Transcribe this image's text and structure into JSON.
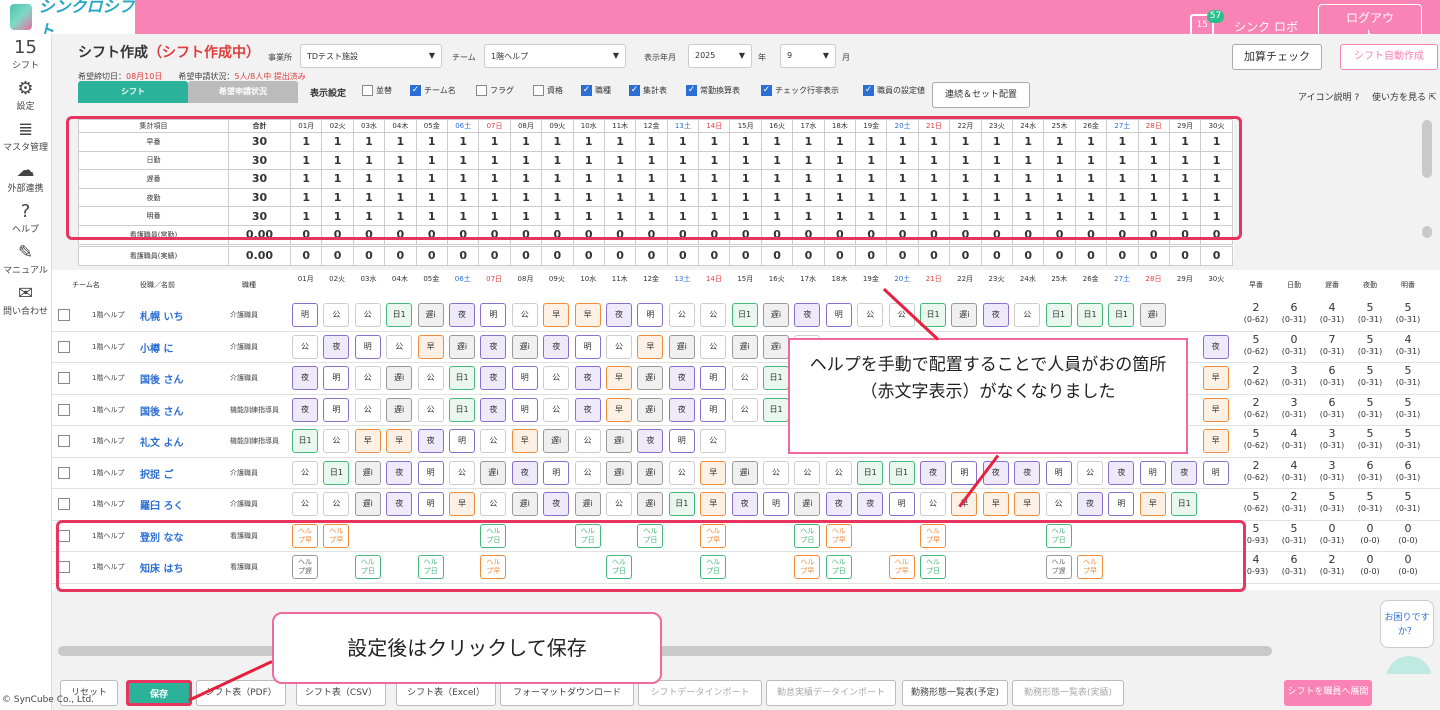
{
  "app": {
    "logo_text": "シンクロシフト",
    "notif_count": "57",
    "cal_day": "15",
    "user": "シンク ロボ",
    "logout": "ログアウト"
  },
  "sidebar": [
    {
      "icon": "calendar-icon",
      "glyph": "15",
      "label": "シフト"
    },
    {
      "icon": "gear-icon",
      "glyph": "⚙",
      "label": "設定"
    },
    {
      "icon": "database-icon",
      "glyph": "≣",
      "label": "マスタ管理"
    },
    {
      "icon": "cloud-icon",
      "glyph": "☁",
      "label": "外部連携"
    },
    {
      "icon": "help-icon",
      "glyph": "?",
      "label": "ヘルプ"
    },
    {
      "icon": "manual-icon",
      "glyph": "✎",
      "label": "マニュアル"
    },
    {
      "icon": "mail-icon",
      "glyph": "✉",
      "label": "問い合わせ"
    }
  ],
  "copyright": "© SynCube Co., Ltd.",
  "page": {
    "title": "シフト作成",
    "status": "（シフト作成中）",
    "office_label": "事業所",
    "office_value": "TDテスト施設",
    "team_label": "チーム",
    "team_value": "1階ヘルプ",
    "ym_label": "表示年月",
    "year_value": "2025",
    "year_unit": "年",
    "month_value": "9",
    "month_unit": "月",
    "deadline_label": "希望締切日：",
    "deadline_value": "08月10日",
    "req_label": "希望申請状況：",
    "req_value": "5人/8人中 提出済み",
    "tab_shift": "シフト",
    "tab_request": "希望申請状況",
    "display_settings": "表示設定",
    "add_check": "加算チェック",
    "auto_create": "シフト自動作成",
    "renzoku": "連続＆セット配置",
    "icon_help": "アイコン説明",
    "how_to": "使い方を見る"
  },
  "checkboxes": [
    {
      "label": "並替",
      "on": false
    },
    {
      "label": "チーム名",
      "on": true
    },
    {
      "label": "フラグ",
      "on": false
    },
    {
      "label": "資格",
      "on": false
    },
    {
      "label": "職種",
      "on": true
    },
    {
      "label": "集計表",
      "on": true
    },
    {
      "label": "常勤換算表",
      "on": true
    },
    {
      "label": "チェック行非表示",
      "on": true
    },
    {
      "label": "職員の設定値",
      "on": true
    }
  ],
  "days": [
    "01月",
    "02火",
    "03水",
    "04木",
    "05金",
    "06土",
    "07日",
    "08月",
    "09火",
    "10水",
    "11木",
    "12金",
    "13土",
    "14日",
    "15月",
    "16火",
    "17水",
    "18木",
    "19金",
    "20土",
    "21日",
    "22月",
    "23火",
    "24水",
    "25木",
    "26金",
    "27土",
    "28日",
    "29月",
    "30火"
  ],
  "summary": {
    "header_label": "集計項目",
    "header_total": "合計",
    "rows": [
      {
        "label": "早番",
        "total": "30",
        "v": "1"
      },
      {
        "label": "日勤",
        "total": "30",
        "v": "1"
      },
      {
        "label": "遅番",
        "total": "30",
        "v": "1"
      },
      {
        "label": "夜勤",
        "total": "30",
        "v": "1"
      },
      {
        "label": "明番",
        "total": "30",
        "v": "1"
      },
      {
        "label": "看護職員(常勤)",
        "total": "0.00",
        "v": "0"
      },
      {
        "label": "看護職員(実績)",
        "total": "0.00",
        "v": "0"
      }
    ]
  },
  "grid_headers": {
    "team": "チーム名",
    "name": "役職／名前",
    "role": "職種",
    "stats": [
      "早番",
      "日勤",
      "遅番",
      "夜勤",
      "明番"
    ]
  },
  "staff": [
    {
      "team": "1階ヘルプ",
      "name": "札幌 いち",
      "role": "介護職員",
      "shifts": [
        "明",
        "公",
        "公",
        "日1",
        "遅i",
        "夜",
        "明",
        "公",
        "早",
        "早",
        "夜",
        "明",
        "公",
        "公",
        "日1",
        "遅i",
        "夜",
        "明",
        "公",
        "公",
        "日1",
        "遅i",
        "夜",
        "公",
        "日1",
        "日1",
        "日1",
        "遅i",
        "",
        ""
      ],
      "stats": [
        [
          "2",
          "(0-62)"
        ],
        [
          "6",
          "(0-31)"
        ],
        [
          "4",
          "(0-31)"
        ],
        [
          "5",
          "(0-31)"
        ],
        [
          "5",
          "(0-31)"
        ]
      ]
    },
    {
      "team": "1階ヘルプ",
      "name": "小樽 に",
      "role": "介護職員",
      "shifts": [
        "公",
        "夜",
        "明",
        "公",
        "早",
        "遅i",
        "夜",
        "遅i",
        "夜",
        "明",
        "公",
        "早",
        "遅i",
        "公",
        "遅i",
        "遅i",
        "公",
        "",
        "",
        "",
        "",
        "",
        "",
        "",
        "",
        "",
        "",
        "",
        "",
        "夜"
      ],
      "stats": [
        [
          "5",
          "(0-62)"
        ],
        [
          "0",
          "(0-31)"
        ],
        [
          "7",
          "(0-31)"
        ],
        [
          "5",
          "(0-31)"
        ],
        [
          "4",
          "(0-31)"
        ]
      ]
    },
    {
      "team": "1階ヘルプ",
      "name": "国後 さん",
      "role": "介護職員",
      "shifts": [
        "夜",
        "明",
        "公",
        "遅i",
        "公",
        "日1",
        "夜",
        "明",
        "公",
        "夜",
        "早",
        "遅i",
        "夜",
        "明",
        "公",
        "日1",
        "",
        "",
        "",
        "",
        "",
        "",
        "",
        "",
        "",
        "",
        "",
        "",
        "",
        "早"
      ],
      "stats": [
        [
          "2",
          "(0-62)"
        ],
        [
          "3",
          "(0-31)"
        ],
        [
          "6",
          "(0-31)"
        ],
        [
          "5",
          "(0-31)"
        ],
        [
          "5",
          "(0-31)"
        ]
      ]
    },
    {
      "team": "1階ヘルプ",
      "name": "国後 さん",
      "role": "機能訓練指導員",
      "shifts": [
        "夜",
        "明",
        "公",
        "遅i",
        "公",
        "日1",
        "夜",
        "明",
        "公",
        "夜",
        "早",
        "遅i",
        "夜",
        "明",
        "公",
        "日1",
        "",
        "",
        "",
        "",
        "",
        "",
        "",
        "",
        "",
        "",
        "",
        "",
        "",
        "早"
      ],
      "stats": [
        [
          "2",
          "(0-62)"
        ],
        [
          "3",
          "(0-31)"
        ],
        [
          "6",
          "(0-31)"
        ],
        [
          "5",
          "(0-31)"
        ],
        [
          "5",
          "(0-31)"
        ]
      ]
    },
    {
      "team": "1階ヘルプ",
      "name": "礼文 よん",
      "role": "機能訓練指導員",
      "shifts": [
        "日1",
        "公",
        "早",
        "早",
        "夜",
        "明",
        "公",
        "早",
        "遅i",
        "公",
        "遅i",
        "夜",
        "明",
        "公",
        "",
        "",
        "",
        "",
        "",
        "",
        "",
        "",
        "",
        "",
        "",
        "",
        "",
        "",
        "",
        "早"
      ],
      "stats": [
        [
          "5",
          "(0-62)"
        ],
        [
          "4",
          "(0-31)"
        ],
        [
          "3",
          "(0-31)"
        ],
        [
          "5",
          "(0-31)"
        ],
        [
          "5",
          "(0-31)"
        ]
      ]
    },
    {
      "team": "1階ヘルプ",
      "name": "択捉 ご",
      "role": "介護職員",
      "shifts": [
        "公",
        "日1",
        "遅i",
        "夜",
        "明",
        "公",
        "遅i",
        "夜",
        "明",
        "公",
        "遅i",
        "遅i",
        "公",
        "早",
        "遅i",
        "公",
        "公",
        "公",
        "日1",
        "日1",
        "夜",
        "明",
        "夜",
        "夜",
        "明",
        "公",
        "夜",
        "明",
        "夜",
        "明"
      ],
      "stats": [
        [
          "2",
          "(0-62)"
        ],
        [
          "4",
          "(0-31)"
        ],
        [
          "3",
          "(0-31)"
        ],
        [
          "6",
          "(0-31)"
        ],
        [
          "6",
          "(0-31)"
        ]
      ]
    },
    {
      "team": "1階ヘルプ",
      "name": "羅臼 ろく",
      "role": "介護職員",
      "shifts": [
        "公",
        "公",
        "遅i",
        "夜",
        "明",
        "早",
        "公",
        "遅i",
        "夜",
        "遅i",
        "公",
        "遅i",
        "日1",
        "早",
        "夜",
        "明",
        "遅i",
        "夜",
        "夜",
        "明",
        "公",
        "早",
        "早",
        "早",
        "公",
        "夜",
        "明",
        "早",
        "日1",
        ""
      ],
      "stats": [
        [
          "5",
          "(0-62)"
        ],
        [
          "2",
          "(0-31)"
        ],
        [
          "5",
          "(0-31)"
        ],
        [
          "5",
          "(0-31)"
        ],
        [
          "5",
          "(0-31)"
        ]
      ]
    },
    {
      "team": "1階ヘルプ",
      "name": "登別 なな",
      "role": "看護職員",
      "shifts": [
        "ヘル\nプ早",
        "ヘル\nプ早",
        "",
        "",
        "",
        "",
        "ヘル\nプ日",
        "",
        "",
        "ヘル\nプ日",
        "",
        "ヘル\nプ日",
        "",
        "ヘル\nプ早",
        "",
        "",
        "ヘル\nプ日",
        "ヘル\nプ早",
        "",
        "",
        "ヘル\nプ早",
        "",
        "",
        "",
        "ヘル\nプ日",
        "",
        "",
        "",
        "",
        ""
      ],
      "stats": [
        [
          "5",
          "(0-93)"
        ],
        [
          "5",
          "(0-31)"
        ],
        [
          "0",
          "(0-31)"
        ],
        [
          "0",
          "(0-0)"
        ],
        [
          "0",
          "(0-0)"
        ]
      ]
    },
    {
      "team": "1階ヘルプ",
      "name": "知床 はち",
      "role": "看護職員",
      "shifts": [
        "ヘル\nプ遅",
        "",
        "ヘル\nプ日",
        "",
        "ヘル\nプ日",
        "",
        "ヘル\nプ早",
        "",
        "",
        "",
        "ヘル\nプ日",
        "",
        "",
        "ヘル\nプ日",
        "",
        "",
        "ヘル\nプ早",
        "ヘル\nプ日",
        "",
        "ヘル\nプ早",
        "ヘル\nプ日",
        "",
        "",
        "",
        "ヘル\nプ遅",
        "ヘル\nプ早",
        "",
        "",
        "",
        ""
      ],
      "stats": [
        [
          "4",
          "(0-93)"
        ],
        [
          "6",
          "(0-31)"
        ],
        [
          "2",
          "(0-31)"
        ],
        [
          "0",
          "(0-0)"
        ],
        [
          "0",
          "(0-0)"
        ]
      ]
    }
  ],
  "callout1": "ヘルプを手動で配置することで人員がおの箇所（赤文字表示）がなくなりました",
  "callout2": "設定後はクリックして保存",
  "footer": [
    "リセット",
    "保存",
    "シフト表（PDF）",
    "シフト表（CSV）",
    "シフト表（Excel）",
    "フォーマットダウンロード",
    "シフトデータインポート",
    "勤怠実績データインポート",
    "勤務形態一覧表(予定)",
    "勤務形態一覧表(実績)",
    "シフトを職員へ展開"
  ],
  "help_bubble": "お困りですか？"
}
